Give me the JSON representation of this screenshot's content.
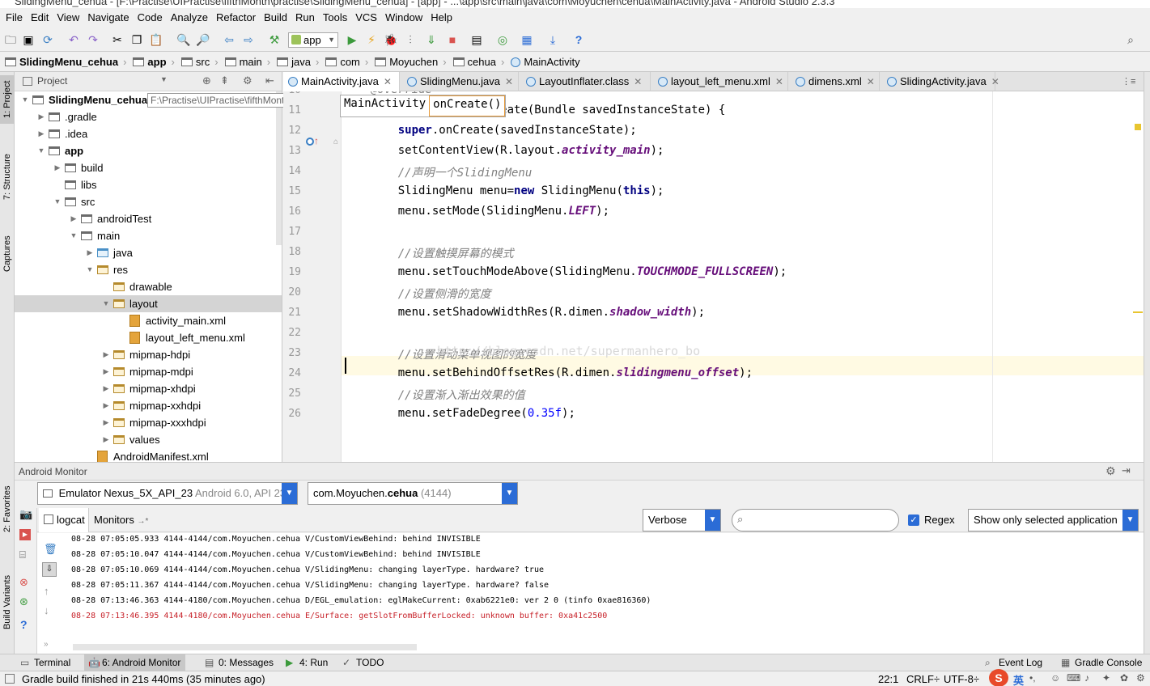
{
  "window": {
    "title": "SlidingMenu_cehua - [F:\\Practise\\UIPractise\\fifthMonth\\practise\\SlidingMenu_cehua] - [app] - ...\\app\\src\\main\\java\\com\\Moyuchen\\cehua\\MainActivity.java - Android Studio 2.3.3"
  },
  "menu": [
    "File",
    "Edit",
    "View",
    "Navigate",
    "Code",
    "Analyze",
    "Refactor",
    "Build",
    "Run",
    "Tools",
    "VCS",
    "Window",
    "Help"
  ],
  "toolbar": {
    "run_config": "app"
  },
  "breadcrumb": [
    "SlidingMenu_cehua",
    "app",
    "src",
    "main",
    "java",
    "com",
    "Moyuchen",
    "cehua",
    "MainActivity"
  ],
  "left_stripe": {
    "project": "1: Project",
    "structure": "7: Structure",
    "captures": "Captures",
    "favorites": "2: Favorites",
    "build_variants": "Build Variants"
  },
  "project_panel": {
    "view_label": "Project",
    "path_hint": "F:\\Practise\\UIPractise\\fifthMonth\\practise\\SlidingMenu_cehua",
    "tree": [
      {
        "label": "SlidingMenu_cehua",
        "extra": "F:\\Practise\\UIPractise\\fifthMonth\\practise\\SlidingMenu_cehua",
        "depth": 0,
        "open": true,
        "bold": true
      },
      {
        "label": ".gradle",
        "depth": 1,
        "open": false
      },
      {
        "label": ".idea",
        "depth": 1,
        "open": false
      },
      {
        "label": "app",
        "depth": 1,
        "open": true,
        "bold": true
      },
      {
        "label": "build",
        "depth": 2,
        "open": false
      },
      {
        "label": "libs",
        "depth": 2,
        "leaf": true
      },
      {
        "label": "src",
        "depth": 2,
        "open": true
      },
      {
        "label": "androidTest",
        "depth": 3,
        "open": false
      },
      {
        "label": "main",
        "depth": 3,
        "open": true
      },
      {
        "label": "java",
        "depth": 4,
        "open": false
      },
      {
        "label": "res",
        "depth": 4,
        "open": true
      },
      {
        "label": "drawable",
        "depth": 5,
        "leaf": true
      },
      {
        "label": "layout",
        "depth": 5,
        "open": true,
        "selected": true
      },
      {
        "label": "activity_main.xml",
        "depth": 6,
        "file": true
      },
      {
        "label": "layout_left_menu.xml",
        "depth": 6,
        "file": true
      },
      {
        "label": "mipmap-hdpi",
        "depth": 5,
        "open": false
      },
      {
        "label": "mipmap-mdpi",
        "depth": 5,
        "open": false
      },
      {
        "label": "mipmap-xhdpi",
        "depth": 5,
        "open": false
      },
      {
        "label": "mipmap-xxhdpi",
        "depth": 5,
        "open": false
      },
      {
        "label": "mipmap-xxxhdpi",
        "depth": 5,
        "open": false
      },
      {
        "label": "values",
        "depth": 5,
        "open": false
      },
      {
        "label": "AndroidManifest.xml",
        "depth": 4,
        "file": true
      }
    ]
  },
  "editor_tabs": [
    {
      "label": "MainActivity.java",
      "active": true
    },
    {
      "label": "SlidingMenu.java"
    },
    {
      "label": "LayoutInflater.class"
    },
    {
      "label": "layout_left_menu.xml"
    },
    {
      "label": "dimens.xml"
    },
    {
      "label": "SlidingActivity.java"
    }
  ],
  "editor": {
    "breadcrumb_popup": [
      "MainActivity",
      "onCreate()"
    ],
    "watermark": "http://blog.csdn.net/supermanhero_bo",
    "lines": [
      {
        "n": "10",
        "html": "<span class='cmt'>@Override</span>"
      },
      {
        "n": "11",
        "html": "<span class='kw'>protected void</span> onCreate(Bundle savedInstanceState) {"
      },
      {
        "n": "12",
        "html": "    <span class='kw'>super</span>.onCreate(savedInstanceState);"
      },
      {
        "n": "13",
        "html": "    setContentView(R.layout.<span class='fld'>activity_main</span>);"
      },
      {
        "n": "14",
        "html": "    <span class='cmt'>//声明一个SlidingMenu</span>"
      },
      {
        "n": "15",
        "html": "    SlidingMenu menu=<span class='kw'>new</span> SlidingMenu(<span class='kw'>this</span>);"
      },
      {
        "n": "16",
        "html": "    menu.setMode(SlidingMenu.<span class='fld'>LEFT</span>);"
      },
      {
        "n": "17",
        "html": ""
      },
      {
        "n": "18",
        "html": "    <span class='cmt'>//设置触摸屏幕的模式</span>"
      },
      {
        "n": "19",
        "html": "    menu.setTouchModeAbove(SlidingMenu.<span class='fld'>TOUCHMODE_FULLSCREEN</span>);"
      },
      {
        "n": "20",
        "html": "    <span class='cmt'>//设置侧滑的宽度</span>"
      },
      {
        "n": "21",
        "html": "    menu.setShadowWidthRes(R.dimen.<span class='fld'>shadow_width</span>);"
      },
      {
        "n": "22",
        "html": ""
      },
      {
        "n": "23",
        "html": "    <span class='cmt'>//设置滑动菜单视图的宽度</span>"
      },
      {
        "n": "24",
        "html": "    menu.setBehindOffsetRes(R.dimen.<span class='fld'>slidingmenu_offset</span>);"
      },
      {
        "n": "25",
        "html": "    <span class='cmt'>//设置渐入渐出效果的值</span>"
      },
      {
        "n": "26",
        "html": "    menu.setFadeDegree(<span class='num'>0.35f</span>);"
      }
    ]
  },
  "monitor": {
    "title": "Android Monitor",
    "device": "Emulator Nexus_5X_API_23",
    "device_detail": "Android 6.0, API 23",
    "process": "com.Moyuchen.",
    "process_bold": "cehua",
    "process_pid": "(4144)",
    "tab_logcat": "logcat",
    "tab_monitors": "Monitors",
    "log_level": "Verbose",
    "search_placeholder": "",
    "regex_label": "Regex",
    "regex_checked": true,
    "filter": "Show only selected application",
    "log_lines": [
      {
        "text": "08-28 07:05:05.933 4144-4144/com.Moyuchen.cehua V/CustomViewBehind: behind INVISIBLE",
        "level": "V"
      },
      {
        "text": "08-28 07:05:10.047 4144-4144/com.Moyuchen.cehua V/CustomViewBehind: behind INVISIBLE",
        "level": "V"
      },
      {
        "text": "08-28 07:05:10.069 4144-4144/com.Moyuchen.cehua V/SlidingMenu: changing layerType. hardware? true",
        "level": "V"
      },
      {
        "text": "08-28 07:05:11.367 4144-4144/com.Moyuchen.cehua V/SlidingMenu: changing layerType. hardware? false",
        "level": "V"
      },
      {
        "text": "08-28 07:13:46.363 4144-4180/com.Moyuchen.cehua D/EGL_emulation: eglMakeCurrent: 0xab6221e0: ver 2 0 (tinfo 0xae816360)",
        "level": "D"
      },
      {
        "text": "08-28 07:13:46.395 4144-4180/com.Moyuchen.cehua E/Surface: getSlotFromBufferLocked: unknown buffer: 0xa41c2500",
        "level": "E"
      }
    ]
  },
  "bottom_tabs": [
    {
      "label": "Terminal"
    },
    {
      "label": "6: Android Monitor",
      "active": true
    },
    {
      "label": "0: Messages"
    },
    {
      "label": "4: Run"
    },
    {
      "label": "TODO"
    }
  ],
  "bottom_right_tabs": [
    "Event Log",
    "Gradle Console"
  ],
  "status": {
    "message": "Gradle build finished in 21s 440ms (35 minutes ago)",
    "position": "22:1",
    "line_sep": "CRLF÷",
    "encoding": "UTF-8÷",
    "ime": "英"
  },
  "colors": {
    "accent": "#2b6cd6",
    "selection": "#d4d4d4",
    "current_line": "#fffae3",
    "error_log": "#c7222a"
  }
}
